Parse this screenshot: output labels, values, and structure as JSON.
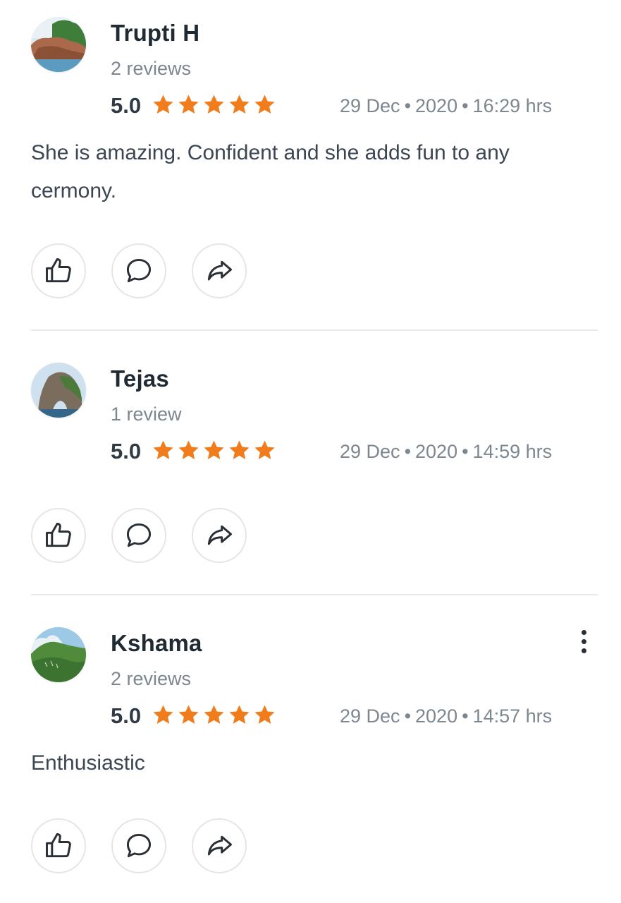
{
  "reviews": [
    {
      "name": "Trupti H",
      "review_count": "2 reviews",
      "score": "5.0",
      "stars": 5,
      "date": "29 Dec",
      "year": "2020",
      "time": "16:29 hrs",
      "separator": "•",
      "text": "She is amazing. Confident and she adds fun to any cermony.",
      "avatar_icon": "avatar-coast-cliff"
    },
    {
      "name": "Tejas",
      "review_count": "1 review",
      "score": "5.0",
      "stars": 5,
      "date": "29 Dec",
      "year": "2020",
      "time": "14:59 hrs",
      "separator": "•",
      "text": "",
      "avatar_icon": "avatar-rock-arch"
    },
    {
      "name": "Kshama",
      "review_count": "2 reviews",
      "score": "5.0",
      "stars": 5,
      "date": "29 Dec",
      "year": "2020",
      "time": "14:57 hrs",
      "separator": "•",
      "text": "Enthusiastic",
      "avatar_icon": "avatar-green-hills"
    }
  ],
  "actions": {
    "like_icon": "thumbs-up-icon",
    "comment_icon": "comment-icon",
    "share_icon": "share-icon"
  },
  "more_icon": "more-vertical-icon",
  "colors": {
    "star": "#f07c1b",
    "name": "#1f2a33",
    "muted": "#7d8790",
    "divider": "#e8eaec"
  }
}
